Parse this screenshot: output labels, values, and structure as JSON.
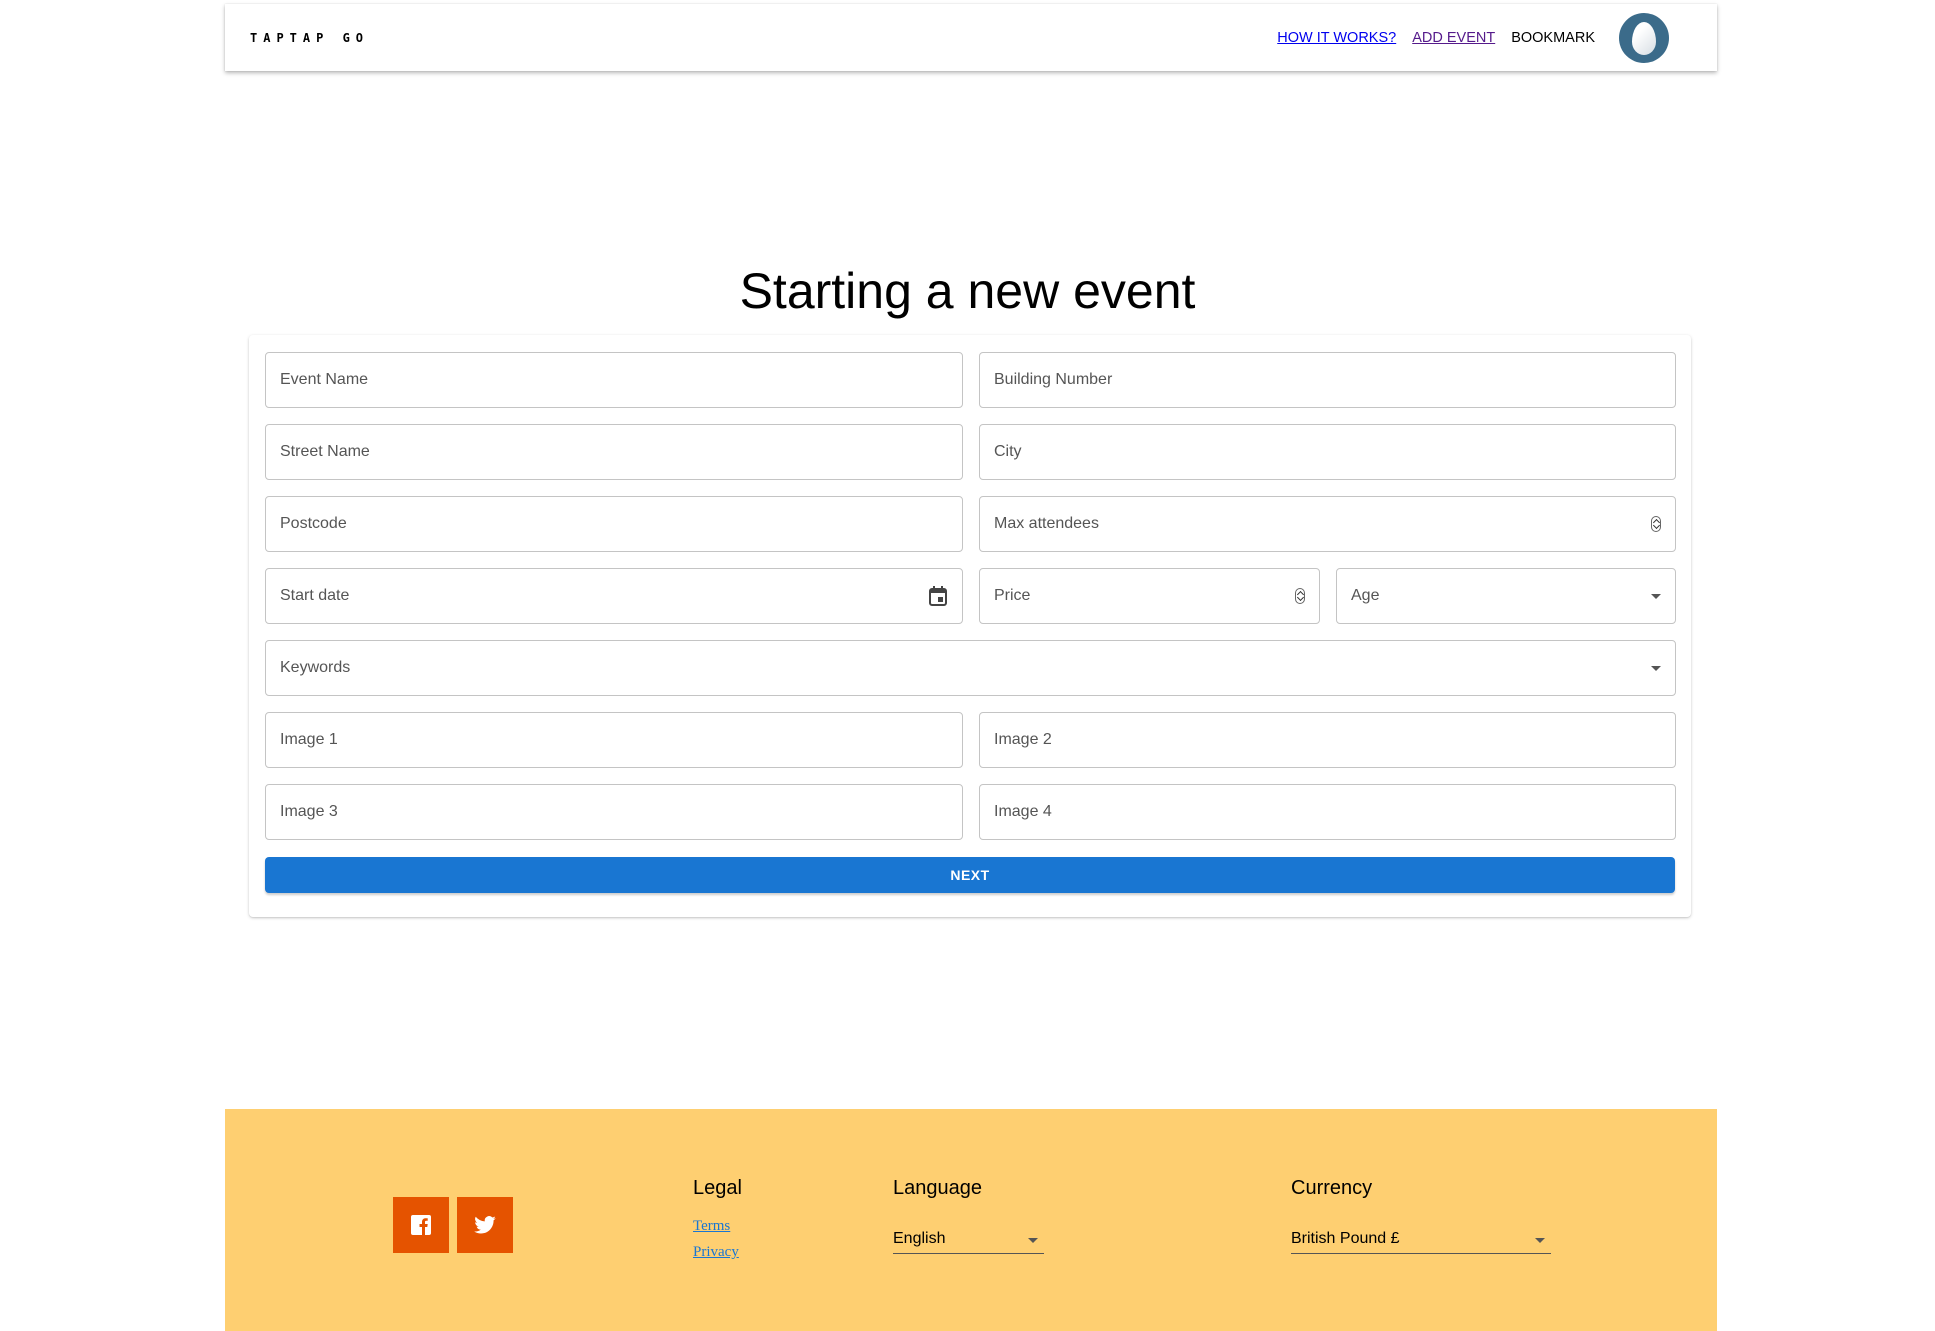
{
  "header": {
    "brand": "TAPTAP GO",
    "nav": {
      "how": "HOW IT WORKS?",
      "add": "ADD EVENT",
      "bookmark": "BOOKMARK"
    }
  },
  "page": {
    "title": "Starting a new event"
  },
  "form": {
    "event_name": "Event Name",
    "building_number": "Building Number",
    "street_name": "Street Name",
    "city": "City",
    "postcode": "Postcode",
    "max_attendees": "Max attendees",
    "start_date": "Start date",
    "price": "Price",
    "age": "Age",
    "keywords": "Keywords",
    "image1": "Image 1",
    "image2": "Image 2",
    "image3": "Image 3",
    "image4": "Image 4",
    "next_label": "NEXT"
  },
  "footer": {
    "legal": {
      "title": "Legal",
      "terms": "Terms",
      "privacy": "Privacy"
    },
    "language": {
      "title": "Language",
      "value": "English"
    },
    "currency": {
      "title": "Currency",
      "value": "British Pound £"
    },
    "social_color": "#e55300",
    "background": "#fecf71"
  }
}
